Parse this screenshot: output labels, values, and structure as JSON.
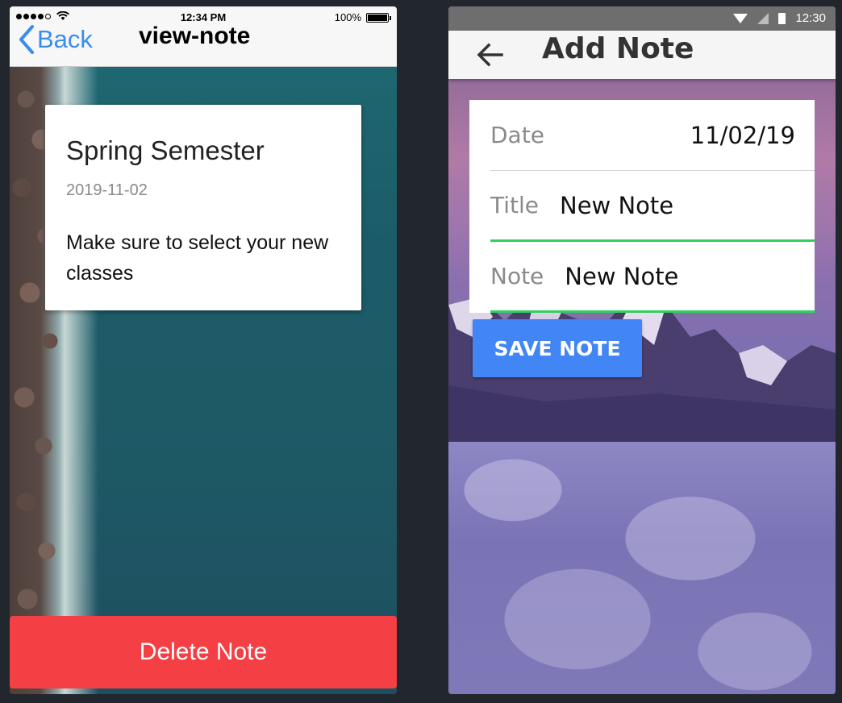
{
  "ios": {
    "status": {
      "time": "12:34 PM",
      "battery": "100%"
    },
    "nav": {
      "back_label": "Back",
      "title": "view-note"
    },
    "note": {
      "title": "Spring Semester",
      "date": "2019-11-02",
      "body": "Make sure to select your new classes"
    },
    "delete_label": "Delete Note",
    "colors": {
      "accent": "#3a8cf0",
      "delete": "#f43f45"
    }
  },
  "android": {
    "status": {
      "time": "12:30"
    },
    "toolbar": {
      "title": "Add Note"
    },
    "form": {
      "date_label": "Date",
      "date_value": "11/02/19",
      "title_label": "Title",
      "title_value": "New Note",
      "note_label": "Note",
      "note_value": "New Note"
    },
    "save_label": "SAVE NOTE",
    "colors": {
      "accent": "#4285f4",
      "underline": "#2ed15c"
    }
  }
}
